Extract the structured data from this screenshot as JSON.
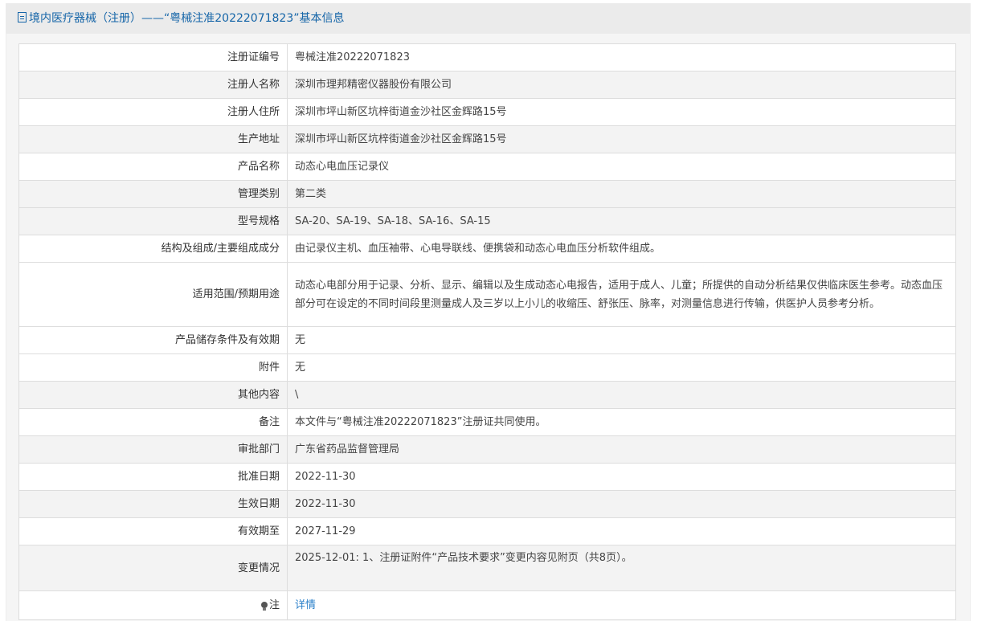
{
  "header": {
    "title": "境内医疗器械（注册）——“粤械注准20222071823”基本信息"
  },
  "rows": [
    {
      "label": "注册证编号",
      "value": "粤械注准20222071823"
    },
    {
      "label": "注册人名称",
      "value": "深圳市理邦精密仪器股份有限公司"
    },
    {
      "label": "注册人住所",
      "value": "深圳市坪山新区坑梓街道金沙社区金辉路15号"
    },
    {
      "label": "生产地址",
      "value": "深圳市坪山新区坑梓街道金沙社区金辉路15号"
    },
    {
      "label": "产品名称",
      "value": "动态心电血压记录仪"
    },
    {
      "label": "管理类别",
      "value": "第二类"
    },
    {
      "label": "型号规格",
      "value": "SA-20、SA-19、SA-18、SA-16、SA-15"
    },
    {
      "label": "结构及组成/主要组成成分",
      "value": "由记录仪主机、血压袖带、心电导联线、便携袋和动态心电血压分析软件组成。"
    },
    {
      "label": "适用范围/预期用途",
      "value": "动态心电部分用于记录、分析、显示、编辑以及生成动态心电报告，适用于成人、儿童；所提供的自动分析结果仅供临床医生参考。动态血压部分可在设定的不同时间段里测量成人及三岁以上小儿的收缩压、舒张压、脉率，对测量信息进行传输，供医护人员参考分析。"
    },
    {
      "label": "产品储存条件及有效期",
      "value": "无"
    },
    {
      "label": "附件",
      "value": "无"
    },
    {
      "label": "其他内容",
      "value": "\\"
    },
    {
      "label": "备注",
      "value": "本文件与“粤械注准20222071823”注册证共同使用。"
    },
    {
      "label": "审批部门",
      "value": "广东省药品监督管理局"
    },
    {
      "label": "批准日期",
      "value": "2022-11-30"
    },
    {
      "label": "生效日期",
      "value": "2022-11-30"
    },
    {
      "label": "有效期至",
      "value": "2027-11-29"
    },
    {
      "label": "变更情况",
      "value": "2025-12-01: 1、注册证附件“产品技术要求”变更内容见附页（共8页）。"
    }
  ],
  "note": {
    "icon": "lightbulb-icon",
    "label": "注",
    "link_text": "详情",
    "link_color": "#2a7fc9"
  },
  "colors": {
    "header_text": "#1565a8",
    "header_bg": "#ebebeb",
    "alt_row_bg": "#f3f3f3",
    "border": "#dddddd"
  }
}
